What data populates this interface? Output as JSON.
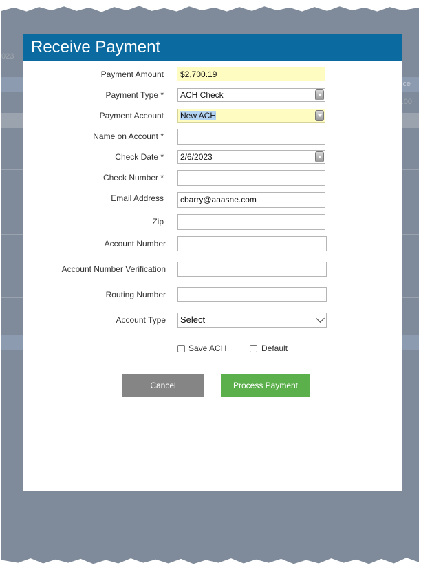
{
  "background": {
    "partial_date": "023",
    "partial_header": "ce",
    "partial_amount": ".00"
  },
  "modal": {
    "title": "Receive Payment",
    "fields": {
      "payment_amount": {
        "label": "Payment Amount",
        "value": "$2,700.19"
      },
      "payment_type": {
        "label": "Payment Type *",
        "value": "ACH Check"
      },
      "payment_account": {
        "label": "Payment Account",
        "value": "New ACH"
      },
      "name_on_account": {
        "label": "Name on Account *",
        "value": ""
      },
      "check_date": {
        "label": "Check Date *",
        "value": "2/6/2023"
      },
      "check_number": {
        "label": "Check Number *",
        "value": ""
      },
      "email_address": {
        "label": "Email Address",
        "value": "cbarry@aaasne.com"
      },
      "zip": {
        "label": "Zip",
        "value": ""
      },
      "account_number": {
        "label": "Account Number",
        "value": ""
      },
      "account_number_verification": {
        "label": "Account Number Verification",
        "value": ""
      },
      "routing_number": {
        "label": "Routing Number",
        "value": ""
      },
      "account_type": {
        "label": "Account Type",
        "value": "Select"
      }
    },
    "checkboxes": {
      "save_ach": "Save ACH",
      "default": "Default"
    },
    "buttons": {
      "cancel": "Cancel",
      "process": "Process Payment"
    }
  },
  "colors": {
    "header": "#0b6aa0",
    "process_button": "#5cb04c",
    "cancel_button": "#858585",
    "amount_highlight": "#fffcc2",
    "backdrop": "#7f8b9a"
  }
}
